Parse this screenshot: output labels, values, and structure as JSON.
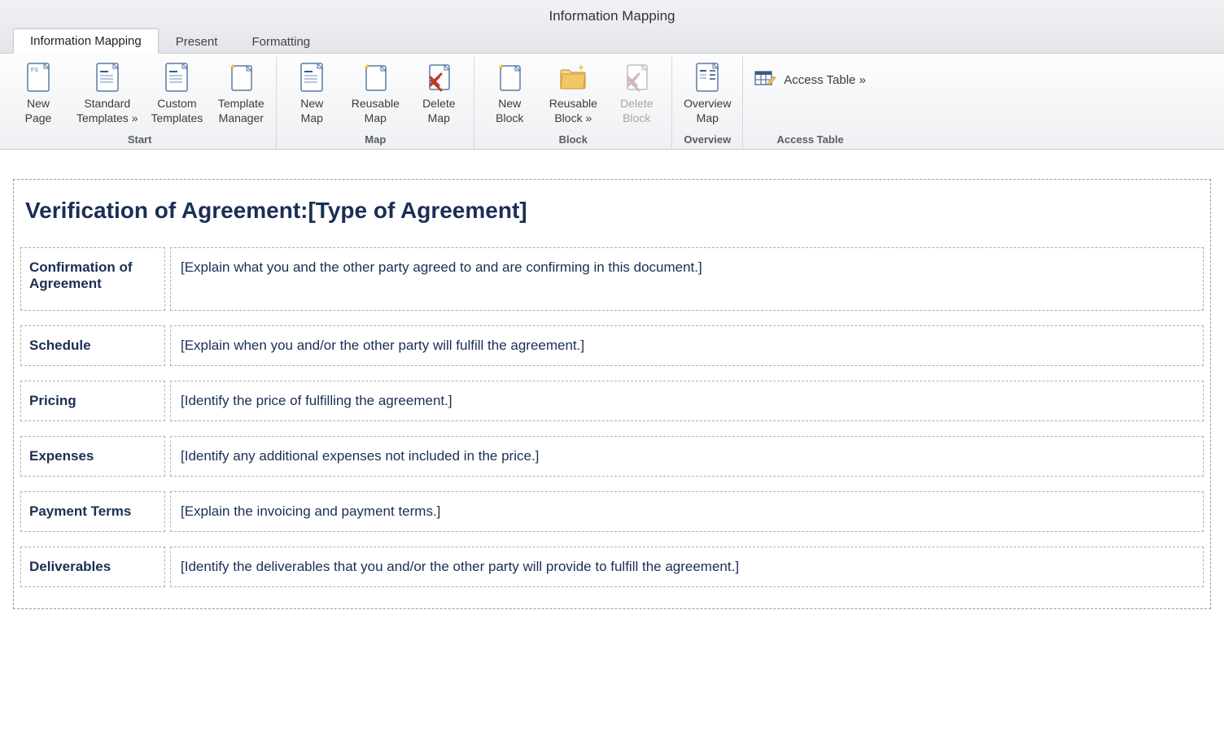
{
  "window": {
    "title": "Information Mapping"
  },
  "tabs": [
    {
      "label": "Information Mapping",
      "active": true
    },
    {
      "label": "Present",
      "active": false
    },
    {
      "label": "Formatting",
      "active": false
    }
  ],
  "ribbon": {
    "groups": [
      {
        "label": "Start",
        "items": [
          {
            "name": "new-page",
            "line1": "New",
            "line2": "Page",
            "icon": "page-fs"
          },
          {
            "name": "standard-templates",
            "line1": "Standard",
            "line2": "Templates »",
            "icon": "page-lines"
          },
          {
            "name": "custom-templates",
            "line1": "Custom",
            "line2": "Templates",
            "icon": "page-lines"
          },
          {
            "name": "template-manager",
            "line1": "Template",
            "line2": "Manager",
            "icon": "page-spark"
          }
        ]
      },
      {
        "label": "Map",
        "items": [
          {
            "name": "new-map",
            "line1": "New",
            "line2": "Map",
            "icon": "page-lines"
          },
          {
            "name": "reusable-map",
            "line1": "Reusable",
            "line2": "Map",
            "icon": "page-spark"
          },
          {
            "name": "delete-map",
            "line1": "Delete",
            "line2": "Map",
            "icon": "page-x"
          }
        ]
      },
      {
        "label": "Block",
        "items": [
          {
            "name": "new-block",
            "line1": "New",
            "line2": "Block",
            "icon": "page-spark"
          },
          {
            "name": "reusable-block",
            "line1": "Reusable",
            "line2": "Block »",
            "icon": "folder-spark"
          },
          {
            "name": "delete-block",
            "line1": "Delete",
            "line2": "Block",
            "icon": "page-x",
            "disabled": true
          }
        ]
      },
      {
        "label": "Overview",
        "items": [
          {
            "name": "overview-map",
            "line1": "Overview",
            "line2": "Map",
            "icon": "page-list"
          }
        ]
      },
      {
        "label": "Access Table",
        "row_items": [
          {
            "name": "access-table",
            "label": "Access Table »",
            "icon": "table-edit"
          }
        ]
      }
    ]
  },
  "document": {
    "title": "Verification of Agreement:[Type of Agreement]",
    "blocks": [
      {
        "label": "Confirmation of Agreement",
        "content": "[Explain what you and the other party agreed to and are confirming in this document.]",
        "tall": true
      },
      {
        "label": "Schedule",
        "content": "[Explain when you and/or the other party will fulfill the agreement.]"
      },
      {
        "label": "Pricing",
        "content": "[Identify the price of fulfilling the agreement.]"
      },
      {
        "label": "Expenses",
        "content": "[Identify any additional expenses not included in the price.]"
      },
      {
        "label": "Payment Terms",
        "content": "[Explain the invoicing and payment terms.]"
      },
      {
        "label": "Deliverables",
        "content": "[Identify the deliverables that you and/or the other party will provide to fulfill the agreement.]"
      }
    ]
  }
}
